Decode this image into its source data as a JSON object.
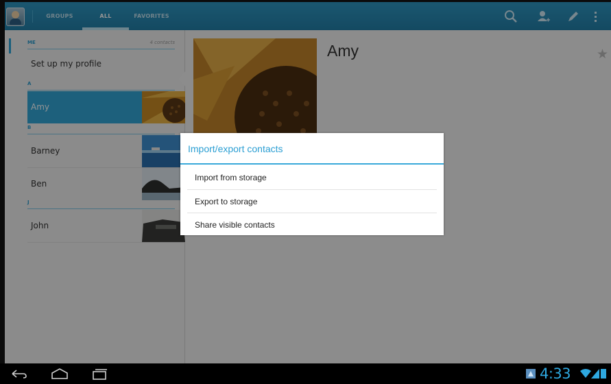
{
  "action_bar": {
    "tabs": [
      {
        "label": "GROUPS",
        "selected": false
      },
      {
        "label": "ALL",
        "selected": true
      },
      {
        "label": "FAVORITES",
        "selected": false
      }
    ],
    "icons": [
      "search-icon",
      "add-contact-icon",
      "edit-icon",
      "overflow-menu-icon"
    ]
  },
  "contacts_list": {
    "me_header": "ME",
    "contact_count": "4 contacts",
    "profile_setup": "Set up my profile",
    "sections": [
      {
        "letter": "A",
        "contacts": [
          "Amy"
        ]
      },
      {
        "letter": "B",
        "contacts": [
          "Barney",
          "Ben"
        ]
      },
      {
        "letter": "J",
        "contacts": [
          "John"
        ]
      }
    ],
    "selected_contact": "Amy"
  },
  "detail": {
    "name": "Amy",
    "favorite_icon": "star-icon"
  },
  "dialog": {
    "title": "Import/export contacts",
    "options": [
      "Import from storage",
      "Export to storage",
      "Share visible contacts"
    ]
  },
  "status_bar": {
    "time": "4:33"
  },
  "colors": {
    "accent": "#33a5d6",
    "action_bar": "#2a8db8",
    "dialog_title": "#2c9fd3"
  }
}
